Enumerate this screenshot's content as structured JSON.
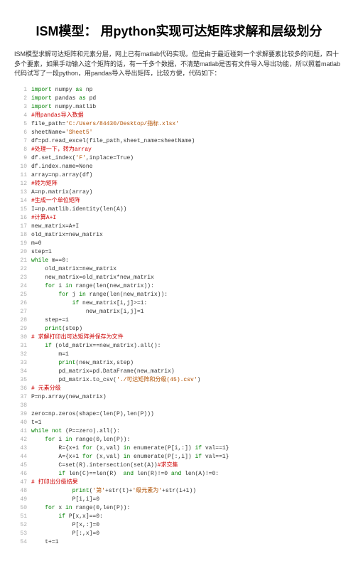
{
  "title": "ISM模型： 用python实现可达矩阵求解和层级划分",
  "intro": "ISM模型求解可达矩阵和元素分层，网上已有matlab代码实现。但是由于最近碰到一个求解要素比较多的问题，四十多个要素，如果手动输入这个矩阵的话，有一千多个数据，不清楚matlab是否有文件导入导出功能，所以照着matlab代码试写了一段python，用pandas导入导出矩阵，比较方便，代码如下：",
  "code_lines": [
    {
      "n": 1,
      "html": "<span class='kw'>import</span> numpy <span class='kw'>as</span> np"
    },
    {
      "n": 2,
      "html": "<span class='kw'>import</span> pandas <span class='kw'>as</span> pd"
    },
    {
      "n": 3,
      "html": "<span class='kw'>import</span> numpy.matlib"
    },
    {
      "n": 4,
      "html": "<span class='cm'>#用pandas导入数据</span>"
    },
    {
      "n": 5,
      "html": "file_path=<span class='str'>'C:/Users/84430/Desktop/指标.xlsx'</span>"
    },
    {
      "n": 6,
      "html": "sheetName=<span class='str'>'Sheet5'</span>"
    },
    {
      "n": 7,
      "html": "df=pd.read_excel(file_path,sheet_name=sheetName)"
    },
    {
      "n": 8,
      "html": "<span class='cm'>#处理一下，转为array</span>"
    },
    {
      "n": 9,
      "html": "df.set_index(<span class='str'>'F'</span>,inplace=True)"
    },
    {
      "n": 10,
      "html": "df.index.name=None"
    },
    {
      "n": 11,
      "html": "array=np.array(df)"
    },
    {
      "n": 12,
      "html": "<span class='cm'>#转为矩阵</span>"
    },
    {
      "n": 13,
      "html": "A=np.matrix(array)"
    },
    {
      "n": 14,
      "html": "<span class='cm'>#生成一个单位矩阵</span>"
    },
    {
      "n": 15,
      "html": "I=np.matlib.identity(len(A))"
    },
    {
      "n": 16,
      "html": "<span class='cm'>#计算A+I</span>"
    },
    {
      "n": 17,
      "html": "new_matrix=A+I"
    },
    {
      "n": 18,
      "html": "old_matrix=new_matrix"
    },
    {
      "n": 19,
      "html": "m=0"
    },
    {
      "n": 20,
      "html": "step=1"
    },
    {
      "n": 21,
      "html": "<span class='kw'>while</span> m==0:"
    },
    {
      "n": 22,
      "html": "    old_matrix=new_matrix"
    },
    {
      "n": 23,
      "html": "    new_matrix=old_matrix*new_matrix"
    },
    {
      "n": 24,
      "html": "    <span class='kw'>for</span> i <span class='kw'>in</span> range(len(new_matrix)):"
    },
    {
      "n": 25,
      "html": "        <span class='kw'>for</span> j <span class='kw'>in</span> range(len(new_matrix)):"
    },
    {
      "n": 26,
      "html": "            <span class='kw'>if</span> new_matrix[i,j]&gt;=1:"
    },
    {
      "n": 27,
      "html": "                new_matrix[i,j]=1"
    },
    {
      "n": 28,
      "html": "    step+=1"
    },
    {
      "n": 29,
      "html": "    <span class='kw'>print</span>(step)"
    },
    {
      "n": 30,
      "html": "<span class='cm'># 求解打印出可达矩阵并保存为文件</span>"
    },
    {
      "n": 31,
      "html": "    <span class='kw'>if</span> (old_matrix==new_matrix).all():"
    },
    {
      "n": 32,
      "html": "        m=1"
    },
    {
      "n": 33,
      "html": "        <span class='kw'>print</span>(new_matrix,step)"
    },
    {
      "n": 34,
      "html": "        pd_matrix=pd.DataFrame(new_matrix)"
    },
    {
      "n": 35,
      "html": "        pd_matrix.to_csv(<span class='str'>'./可达矩阵和分级(45).csv'</span>)"
    },
    {
      "n": 36,
      "html": "<span class='cm'># 元素分级</span>"
    },
    {
      "n": 37,
      "html": "P=np.array(new_matrix)"
    },
    {
      "n": 38,
      "html": ""
    },
    {
      "n": 39,
      "html": "zero=np.zeros(shape=(len(P),len(P)))"
    },
    {
      "n": 40,
      "html": "t=1"
    },
    {
      "n": 41,
      "html": "<span class='kw'>while</span> <span class='kw'>not</span> (P==zero).all():"
    },
    {
      "n": 42,
      "html": "    <span class='kw'>for</span> i <span class='kw'>in</span> range(0,len(P)):"
    },
    {
      "n": 43,
      "html": "        R={x+1 <span class='kw'>for</span> (x,val) <span class='kw'>in</span> enumerate(P[i,:]) <span class='kw'>if</span> val==1}"
    },
    {
      "n": 44,
      "html": "        A={x+1 <span class='kw'>for</span> (x,val) <span class='kw'>in</span> enumerate(P[:,i]) <span class='kw'>if</span> val==1}"
    },
    {
      "n": 45,
      "html": "        C=set(R).intersection(set(A))<span class='cm'>#求交集</span>"
    },
    {
      "n": 46,
      "html": "        <span class='kw'>if</span> len(C)==len(R)  <span class='kw'>and</span> len(R)!=0 <span class='kw'>and</span> len(A)!=0:"
    },
    {
      "n": 47,
      "html": "<span class='cm'># 打印出分级结果</span>"
    },
    {
      "n": 48,
      "html": "            <span class='kw'>print</span>(<span class='str'>'第'</span>+str(t)+<span class='str'>'级元素为'</span>+str(i+1))"
    },
    {
      "n": 49,
      "html": "            P[i,i]=0"
    },
    {
      "n": 50,
      "html": "    <span class='kw'>for</span> x <span class='kw'>in</span> range(0,len(P)):"
    },
    {
      "n": 51,
      "html": "        <span class='kw'>if</span> P[x,x]==0:"
    },
    {
      "n": 52,
      "html": "            P[x,:]=0"
    },
    {
      "n": 53,
      "html": "            P[:,x]=0"
    },
    {
      "n": 54,
      "html": "    t+=1"
    }
  ]
}
